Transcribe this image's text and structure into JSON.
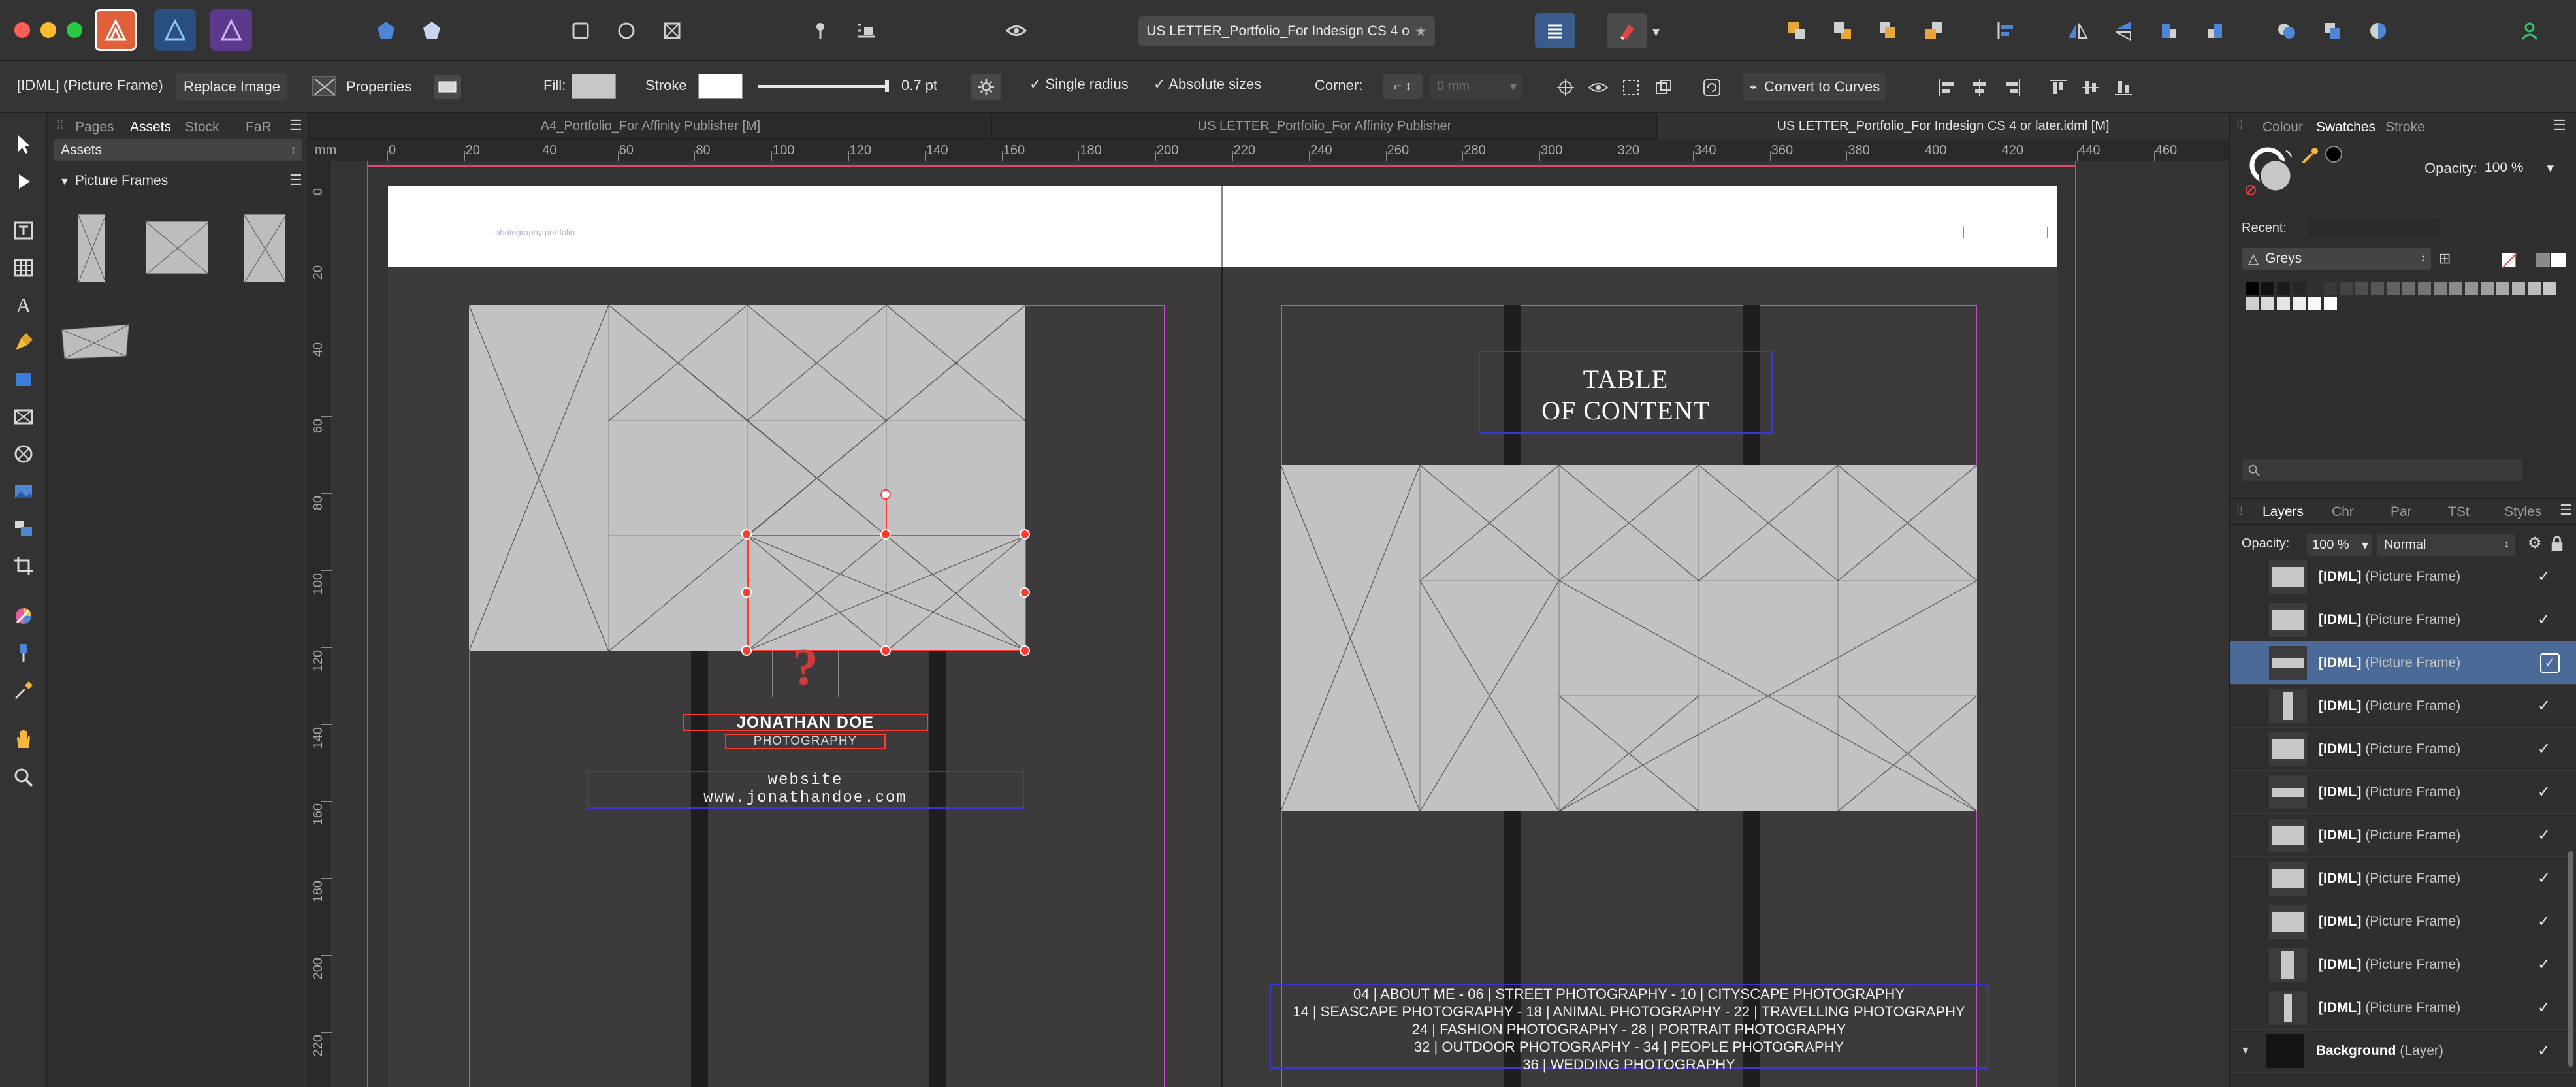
{
  "window": {
    "document_title": "US LETTER_Portfolio_For Indesign CS 4 o",
    "traffic_lights": [
      "#fe5f57",
      "#febc2e",
      "#28c840"
    ]
  },
  "toolbar_icons": [
    "affinity-designer-icon",
    "affinity-photo-icon",
    "persona-publisher-icon"
  ],
  "context": {
    "selection_label": "[IDML] (Picture Frame)",
    "replace_image": "Replace Image",
    "properties": "Properties",
    "fill_label": "Fill:",
    "stroke_label": "Stroke",
    "stroke_width": "0.7 pt",
    "single_radius": "Single radius",
    "absolute_sizes": "Absolute sizes",
    "corner_label": "Corner:",
    "corner_value": "0 mm",
    "convert": "Convert to Curves",
    "fill_color": "#c7c7c7",
    "stroke_color": "#ffffff"
  },
  "doc_tabs": [
    {
      "label": "A4_Portfolio_For Affinity Publisher [M]"
    },
    {
      "label": "US LETTER_Portfolio_For Affinity Publisher"
    },
    {
      "label": "US LETTER_Portfolio_For Indesign CS 4 or later.idml [M]"
    }
  ],
  "left_panel": {
    "tabs": [
      "Pages",
      "Assets",
      "Stock",
      "FaR"
    ],
    "dropdown": "Assets",
    "category": "Picture Frames"
  },
  "ruler": {
    "unit": "mm",
    "top": [
      "0",
      "20",
      "40",
      "60",
      "80",
      "100",
      "120",
      "140",
      "160",
      "180",
      "200",
      "220",
      "240",
      "260",
      "280",
      "300",
      "320",
      "340",
      "360",
      "380",
      "400",
      "420",
      "440",
      "460"
    ],
    "left": [
      "0",
      "20",
      "40",
      "60",
      "80",
      "100",
      "120",
      "140",
      "160",
      "180",
      "200",
      "220"
    ]
  },
  "spread": {
    "header_text": "photography portfolio",
    "name": "JONATHAN DOE",
    "profession": "PHOTOGRAPHY",
    "website_label": "website",
    "website_url": "www.jonathandoe.com",
    "question_mark": "?",
    "toc_title_1": "TABLE",
    "toc_title_2": "OF CONTENT",
    "toc_lines": [
      "04 | ABOUT ME  -  06 | STREET PHOTOGRAPHY  -  10 | CITYSCAPE PHOTOGRAPHY",
      "14 | SEASCAPE PHOTOGRAPHY  -  18 | ANIMAL PHOTOGRAPHY  -  22 | TRAVELLING PHOTOGRAPHY",
      "24 | FASHION PHOTOGRAPHY  -  28 | PORTRAIT  PHOTOGRAPHY",
      "32 | OUTDOOR PHOTOGRAPHY  -  34 | PEOPLE PHOTOGRAPHY",
      "36 | WEDDING PHOTOGRAPHY"
    ]
  },
  "right_panel": {
    "top_tabs": [
      "Colour",
      "Swatches",
      "Stroke"
    ],
    "opacity_label": "Opacity:",
    "opacity_value": "100 %",
    "recent_label": "Recent:",
    "palette": "Greys",
    "greys": [
      "#000000",
      "#111111",
      "#1c1c1c",
      "#262626",
      "#303030",
      "#3a3a3a",
      "#444444",
      "#4e4e4e",
      "#585858",
      "#626262",
      "#6c6c6c",
      "#767676",
      "#808080",
      "#8a8a8a",
      "#949494",
      "#9e9e9e",
      "#a8a8a8",
      "#b2b2b2",
      "#bcbcbc",
      "#c6c6c6",
      "#d0d0d0",
      "#dadada",
      "#e4e4e4",
      "#eeeeee",
      "#f8f8f8",
      "#ffffff"
    ],
    "layer_tabs": [
      "Layers",
      "Chr",
      "Par",
      "TSt",
      "Styles"
    ],
    "layers_opacity_label": "Opacity:",
    "layers_opacity_value": "100 %",
    "blend_mode": "Normal",
    "layers": [
      {
        "name": "[IDML]",
        "type": "(Picture Frame)"
      },
      {
        "name": "[IDML]",
        "type": "(Picture Frame)"
      },
      {
        "name": "[IDML]",
        "type": "(Picture Frame)"
      },
      {
        "name": "[IDML]",
        "type": "(Picture Frame)"
      },
      {
        "name": "[IDML]",
        "type": "(Picture Frame)"
      },
      {
        "name": "[IDML]",
        "type": "(Picture Frame)"
      },
      {
        "name": "[IDML]",
        "type": "(Picture Frame)"
      },
      {
        "name": "[IDML]",
        "type": "(Picture Frame)"
      },
      {
        "name": "[IDML]",
        "type": "(Picture Frame)"
      },
      {
        "name": "[IDML]",
        "type": "(Picture Frame)"
      },
      {
        "name": "[IDML]",
        "type": "(Picture Frame)"
      }
    ],
    "background_layer": {
      "name": "Background",
      "type": "(Layer)"
    },
    "check": "✓"
  }
}
